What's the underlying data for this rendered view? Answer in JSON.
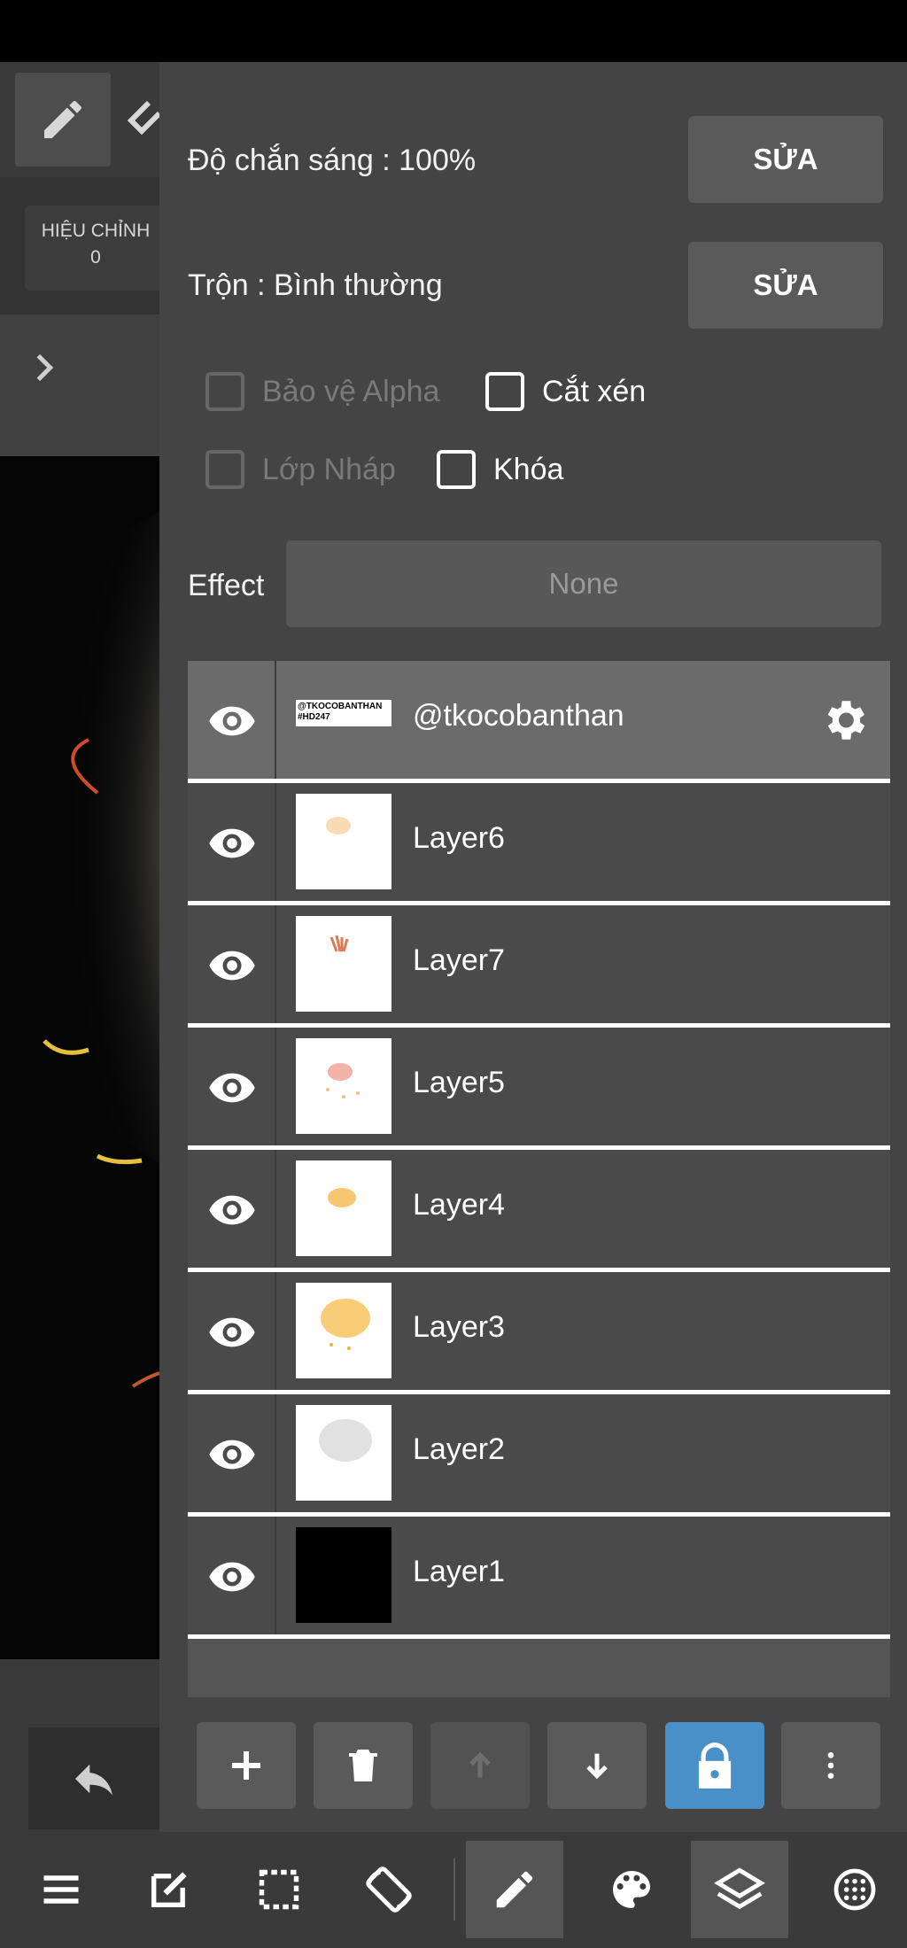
{
  "left_bg": {
    "correction_label": "HIỆU CHỈNH",
    "correction_value": "0"
  },
  "panel": {
    "opacity_label": "Độ chắn sáng : 100%",
    "opacity_edit": "SỬA",
    "blend_label": "Trộn : Bình thường",
    "blend_edit": "SỬA",
    "checkboxes": [
      {
        "label": "Bảo vệ Alpha",
        "checked": false,
        "disabled": true
      },
      {
        "label": "Cắt xén",
        "checked": false,
        "disabled": false
      },
      {
        "label": "Lớp Nháp",
        "checked": false,
        "disabled": true
      },
      {
        "label": "Khóa",
        "checked": false,
        "disabled": false
      }
    ],
    "effect_label": "Effect",
    "effect_value": "None"
  },
  "layers": [
    {
      "name": "@tkocobanthan",
      "selected": true,
      "thumb_text_1": "@TKOCOBANTHAN",
      "thumb_text_2": "#HD247"
    },
    {
      "name": "Layer6"
    },
    {
      "name": "Layer7"
    },
    {
      "name": "Layer5"
    },
    {
      "name": "Layer4"
    },
    {
      "name": "Layer3"
    },
    {
      "name": "Layer2"
    },
    {
      "name": "Layer1"
    }
  ],
  "layer_bar": [
    "add-icon",
    "trash-icon",
    "arrow-up-icon",
    "arrow-down-icon",
    "lock-icon",
    "more-vertical-icon"
  ],
  "bottom_nav": [
    "menu-icon",
    "edit-icon",
    "selection-icon",
    "rotate-screen-icon",
    "pencil-icon",
    "palette-icon",
    "layers-icon",
    "grid-icon"
  ],
  "colors": {
    "panel": "#444444",
    "active_blue": "#4a90c8",
    "selected_layer": "#6b6b6b"
  }
}
